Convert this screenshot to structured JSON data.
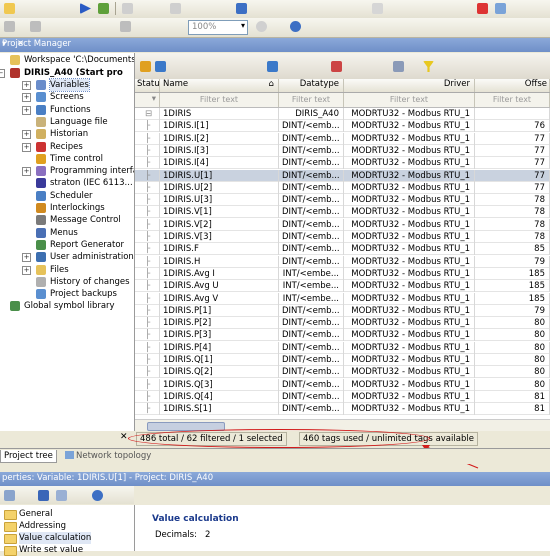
{
  "toolbar": {
    "zoom": "100%"
  },
  "project_manager": {
    "title": "Project Manager",
    "workspace": "Workspace 'C:\\Documents a",
    "project": "DIRIS_A40 (Start pro",
    "tree_items": [
      {
        "label": "Variables",
        "selected": true
      },
      {
        "label": "Screens"
      },
      {
        "label": "Functions"
      },
      {
        "label": "Language file"
      },
      {
        "label": "Historian"
      },
      {
        "label": "Recipes"
      },
      {
        "label": "Time control"
      },
      {
        "label": "Programming interfa..."
      },
      {
        "label": "straton (IEC 6113..."
      },
      {
        "label": "Scheduler"
      },
      {
        "label": "Interlockings"
      },
      {
        "label": "Message Control"
      },
      {
        "label": "Menus"
      },
      {
        "label": "Report Generator"
      },
      {
        "label": "User administration"
      },
      {
        "label": "Files"
      },
      {
        "label": "History of changes"
      },
      {
        "label": "Project backups"
      }
    ],
    "global_library": "Global symbol library"
  },
  "grid": {
    "columns": {
      "status": "Status",
      "name": "Name",
      "datatype": "Datatype",
      "driver": "Driver",
      "offset": "Offse"
    },
    "filter_placeholder": "Filter text",
    "rows": [
      {
        "name": "1DIRIS",
        "datatype": "DIRIS_A40",
        "driver": "MODRTU32 - Modbus RTU_1",
        "offset": ""
      },
      {
        "name": "1DIRIS.I[1]",
        "datatype": "DINT/<emb...",
        "driver": "MODRTU32 - Modbus RTU_1",
        "offset": "76"
      },
      {
        "name": "1DIRIS.I[2]",
        "datatype": "DINT/<emb...",
        "driver": "MODRTU32 - Modbus RTU_1",
        "offset": "77"
      },
      {
        "name": "1DIRIS.I[3]",
        "datatype": "DINT/<emb...",
        "driver": "MODRTU32 - Modbus RTU_1",
        "offset": "77"
      },
      {
        "name": "1DIRIS.I[4]",
        "datatype": "DINT/<emb...",
        "driver": "MODRTU32 - Modbus RTU_1",
        "offset": "77"
      },
      {
        "name": "1DIRIS.U[1]",
        "datatype": "DINT/<emb...",
        "driver": "MODRTU32 - Modbus RTU_1",
        "offset": "77",
        "selected": true
      },
      {
        "name": "1DIRIS.U[2]",
        "datatype": "DINT/<emb...",
        "driver": "MODRTU32 - Modbus RTU_1",
        "offset": "77"
      },
      {
        "name": "1DIRIS.U[3]",
        "datatype": "DINT/<emb...",
        "driver": "MODRTU32 - Modbus RTU_1",
        "offset": "78"
      },
      {
        "name": "1DIRIS.V[1]",
        "datatype": "DINT/<emb...",
        "driver": "MODRTU32 - Modbus RTU_1",
        "offset": "78"
      },
      {
        "name": "1DIRIS.V[2]",
        "datatype": "DINT/<emb...",
        "driver": "MODRTU32 - Modbus RTU_1",
        "offset": "78"
      },
      {
        "name": "1DIRIS.V[3]",
        "datatype": "DINT/<emb...",
        "driver": "MODRTU32 - Modbus RTU_1",
        "offset": "78"
      },
      {
        "name": "1DIRIS.F",
        "datatype": "DINT/<emb...",
        "driver": "MODRTU32 - Modbus RTU_1",
        "offset": "85"
      },
      {
        "name": "1DIRIS.H",
        "datatype": "DINT/<emb...",
        "driver": "MODRTU32 - Modbus RTU_1",
        "offset": "79"
      },
      {
        "name": "1DIRIS.Avg I",
        "datatype": "INT/<embe...",
        "driver": "MODRTU32 - Modbus RTU_1",
        "offset": "185"
      },
      {
        "name": "1DIRIS.Avg U",
        "datatype": "INT/<embe...",
        "driver": "MODRTU32 - Modbus RTU_1",
        "offset": "185"
      },
      {
        "name": "1DIRIS.Avg V",
        "datatype": "INT/<embe...",
        "driver": "MODRTU32 - Modbus RTU_1",
        "offset": "185"
      },
      {
        "name": "1DIRIS.P[1]",
        "datatype": "DINT/<emb...",
        "driver": "MODRTU32 - Modbus RTU_1",
        "offset": "79"
      },
      {
        "name": "1DIRIS.P[2]",
        "datatype": "DINT/<emb...",
        "driver": "MODRTU32 - Modbus RTU_1",
        "offset": "80"
      },
      {
        "name": "1DIRIS.P[3]",
        "datatype": "DINT/<emb...",
        "driver": "MODRTU32 - Modbus RTU_1",
        "offset": "80"
      },
      {
        "name": "1DIRIS.P[4]",
        "datatype": "DINT/<emb...",
        "driver": "MODRTU32 - Modbus RTU_1",
        "offset": "80"
      },
      {
        "name": "1DIRIS.Q[1]",
        "datatype": "DINT/<emb...",
        "driver": "MODRTU32 - Modbus RTU_1",
        "offset": "80"
      },
      {
        "name": "1DIRIS.Q[2]",
        "datatype": "DINT/<emb...",
        "driver": "MODRTU32 - Modbus RTU_1",
        "offset": "80"
      },
      {
        "name": "1DIRIS.Q[3]",
        "datatype": "DINT/<emb...",
        "driver": "MODRTU32 - Modbus RTU_1",
        "offset": "80"
      },
      {
        "name": "1DIRIS.Q[4]",
        "datatype": "DINT/<emb...",
        "driver": "MODRTU32 - Modbus RTU_1",
        "offset": "81"
      },
      {
        "name": "1DIRIS.S[1]",
        "datatype": "DINT/<emb...",
        "driver": "MODRTU32 - Modbus RTU_1",
        "offset": "81"
      }
    ]
  },
  "status_bar": {
    "counts": "486 total / 62 filtered / 1 selected",
    "tags": "460 tags used / unlimited tags available"
  },
  "tabs": {
    "project_tree": "Project tree",
    "network_topology": "Network topology"
  },
  "properties": {
    "title": "perties: Variable: 1DIRIS.U[1] - Project: DIRIS_A40",
    "nav": [
      "General",
      "Addressing",
      "Value calculation",
      "Write set value"
    ],
    "section": "Value calculation",
    "decimals_label": "Decimals:",
    "decimals_value": "2"
  },
  "colors": {
    "title_bar": "#7796cf",
    "selection": "#c9d2df",
    "annotation": "#d21c1c"
  }
}
